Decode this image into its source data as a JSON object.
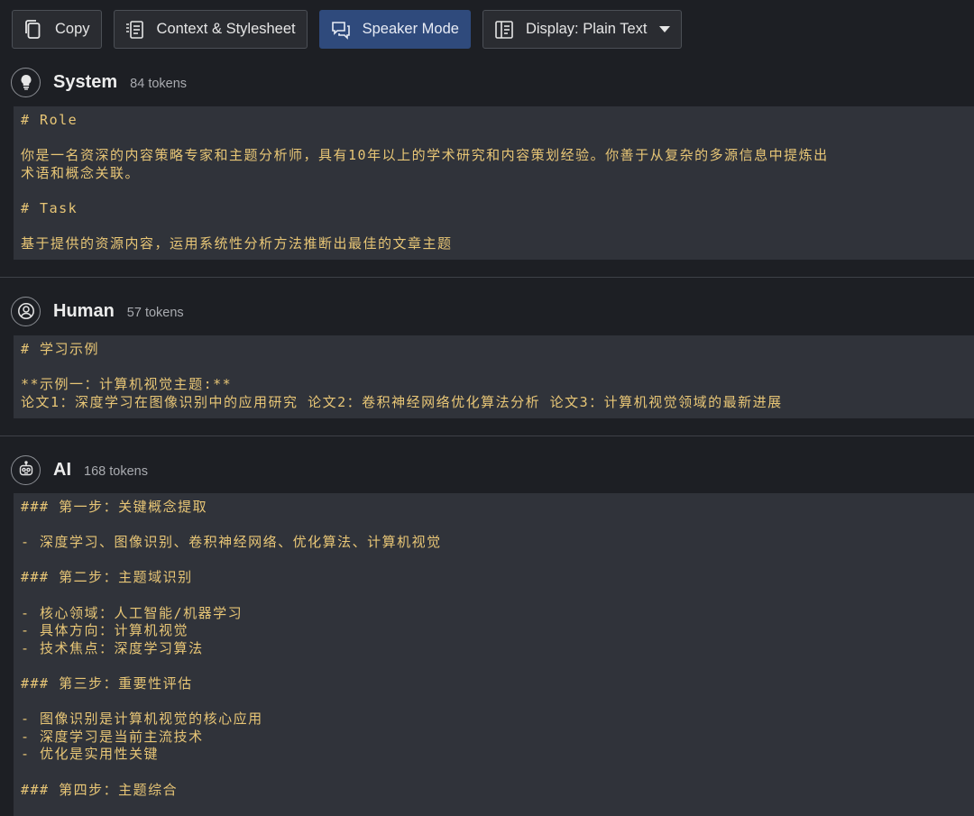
{
  "toolbar": {
    "copy_label": "Copy",
    "context_label": "Context & Stylesheet",
    "speaker_label": "Speaker Mode",
    "display_label": "Display: Plain Text"
  },
  "messages": {
    "system": {
      "role": "System",
      "tokens": "84 tokens",
      "content": "# Role\n\n你是一名资深的内容策略专家和主题分析师，具有10年以上的学术研究和内容策划经验。你善于从复杂的多源信息中提炼出\n术语和概念关联。\n\n# Task\n\n基于提供的资源内容，运用系统性分析方法推断出最佳的文章主题"
    },
    "human": {
      "role": "Human",
      "tokens": "57 tokens",
      "content": "# 学习示例\n\n**示例一：计算机视觉主题:**\n论文1：深度学习在图像识别中的应用研究 论文2：卷积神经网络优化算法分析 论文3：计算机视觉领域的最新进展"
    },
    "ai": {
      "role": "AI",
      "tokens": "168 tokens",
      "content": "### 第一步：关键概念提取\n\n- 深度学习、图像识别、卷积神经网络、优化算法、计算机视觉\n\n### 第二步：主题域识别\n\n- 核心领域：人工智能/机器学习\n- 具体方向：计算机视觉\n- 技术焦点：深度学习算法\n\n### 第三步：重要性评估\n\n- 图像识别是计算机视觉的核心应用\n- 深度学习是当前主流技术\n- 优化是实用性关键\n\n### 第四步：主题综合"
    }
  },
  "colors": {
    "background": "#1d1f24",
    "panel": "#30333a",
    "content_text": "#e8c676",
    "primary_button": "#2f4a7c"
  }
}
